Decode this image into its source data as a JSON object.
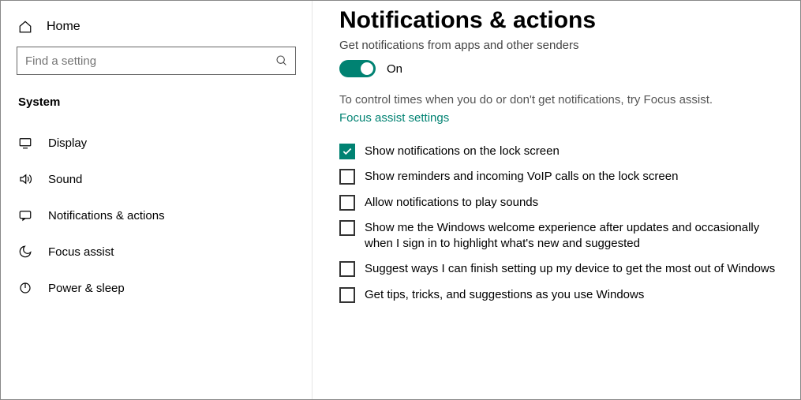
{
  "sidebar": {
    "home_label": "Home",
    "search_placeholder": "Find a setting",
    "section_header": "System",
    "items": [
      {
        "label": "Display"
      },
      {
        "label": "Sound"
      },
      {
        "label": "Notifications & actions"
      },
      {
        "label": "Focus assist"
      },
      {
        "label": "Power & sleep"
      }
    ]
  },
  "main": {
    "title": "Notifications & actions",
    "sub_desc": "Get notifications from apps and other senders",
    "toggle_label": "On",
    "focus_text": "To control times when you do or don't get notifications, try Focus assist.",
    "focus_link": "Focus assist settings",
    "checkboxes": [
      {
        "label": "Show notifications on the lock screen",
        "checked": true
      },
      {
        "label": "Show reminders and incoming VoIP calls on the lock screen",
        "checked": false
      },
      {
        "label": "Allow notifications to play sounds",
        "checked": false
      },
      {
        "label": "Show me the Windows welcome experience after updates and occasionally when I sign in to highlight what's new and suggested",
        "checked": false
      },
      {
        "label": "Suggest ways I can finish setting up my device to get the most out of Windows",
        "checked": false
      },
      {
        "label": "Get tips, tricks, and suggestions as you use Windows",
        "checked": false
      }
    ]
  }
}
